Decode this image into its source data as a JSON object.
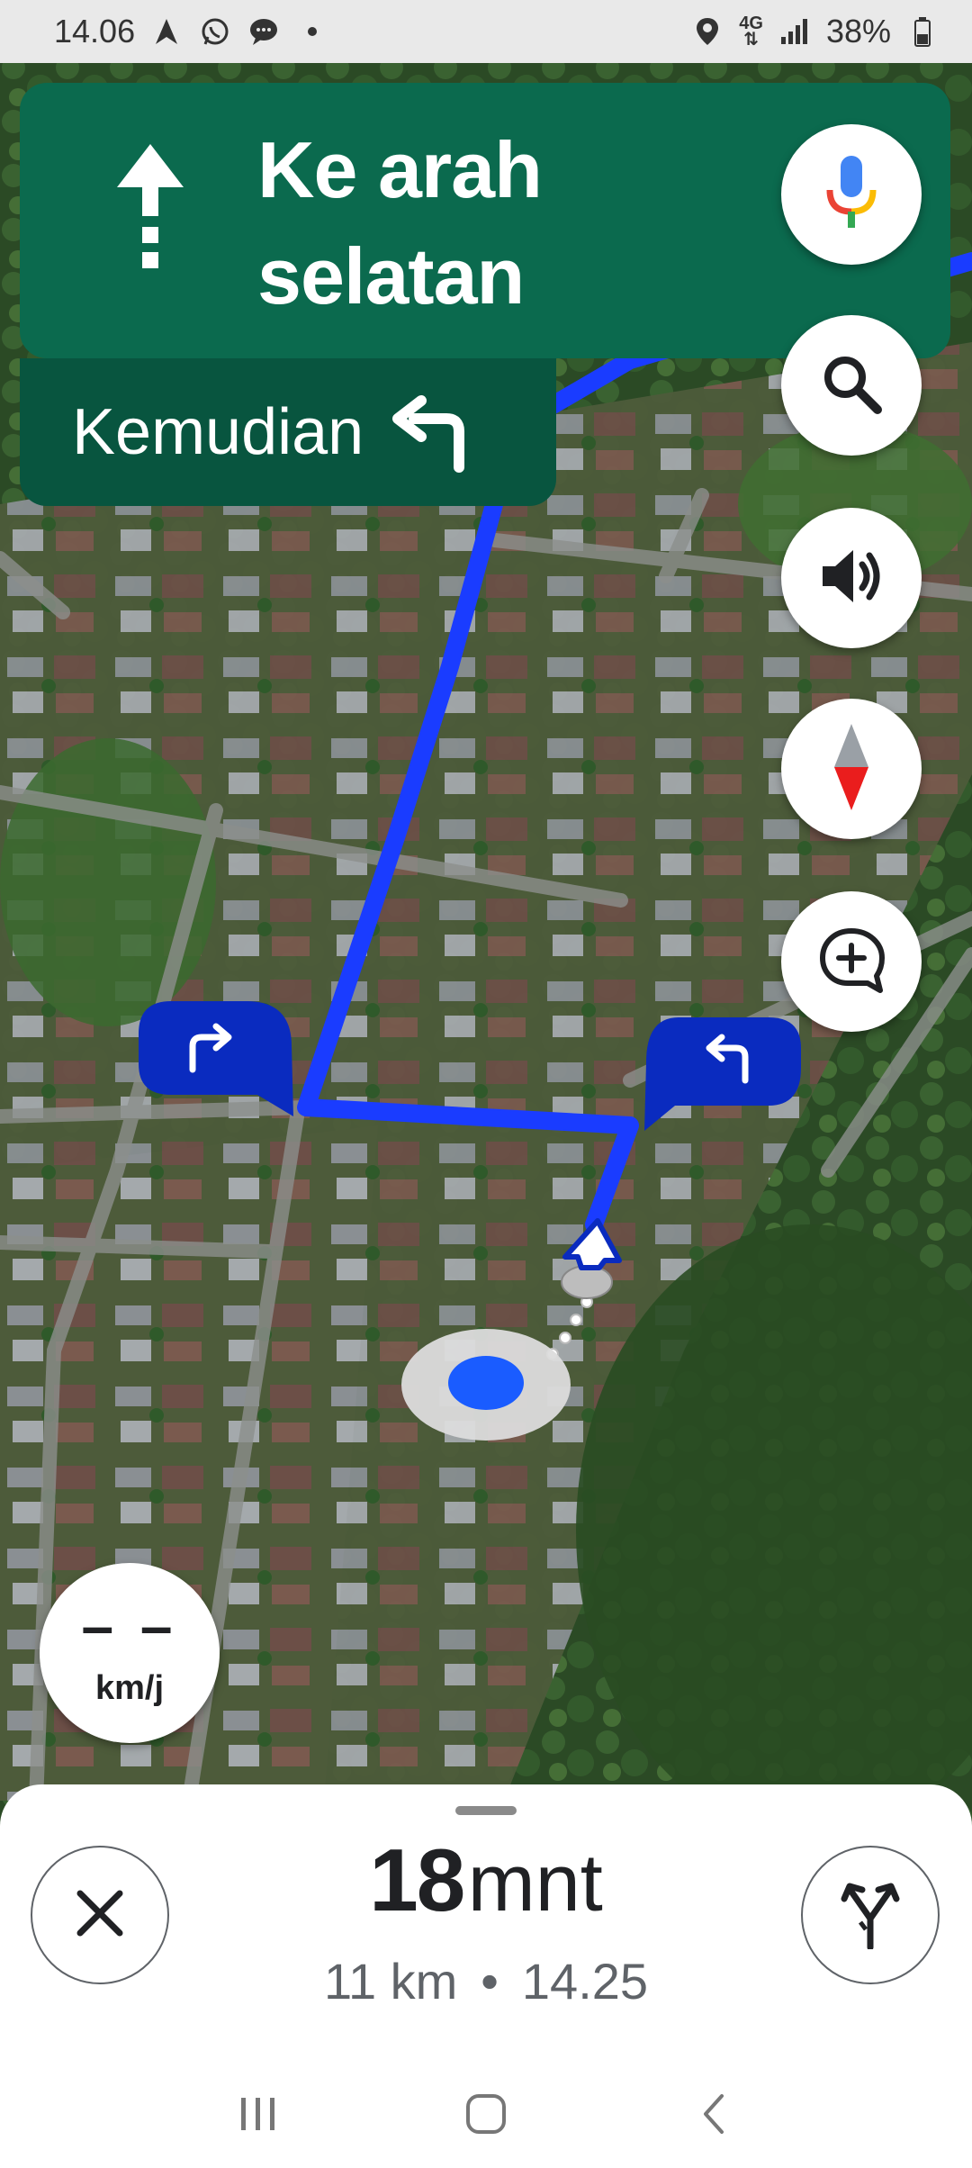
{
  "status_bar": {
    "time": "14.06",
    "network": "4G",
    "battery": "38%",
    "icons_left": [
      "navigation-icon",
      "whatsapp-icon",
      "chat-icon",
      "dot-icon"
    ],
    "icons_right": [
      "location-icon",
      "data-arrows-icon",
      "signal-icon",
      "battery-icon"
    ]
  },
  "direction": {
    "instruction_line1": "Ke arah",
    "instruction_line2": "selatan",
    "then_label": "Kemudian",
    "then_icon": "turn-left-icon",
    "main_icon": "straight-arrow-icon"
  },
  "right_buttons": [
    {
      "name": "voice",
      "icon": "mic-icon"
    },
    {
      "name": "search",
      "icon": "search-icon"
    },
    {
      "name": "sound",
      "icon": "speaker-icon"
    },
    {
      "name": "compass",
      "icon": "compass-icon"
    },
    {
      "name": "report",
      "icon": "add-report-icon"
    }
  ],
  "turn_bubbles": [
    "turn-right-icon",
    "turn-left-icon"
  ],
  "speed": {
    "value": "– –",
    "unit": "km/j"
  },
  "trip": {
    "minutes": "18",
    "minutes_unit": "mnt",
    "distance": "11 km",
    "separator": "•",
    "arrival": "14.25"
  },
  "colors": {
    "direction_card": "#0b6a4e",
    "then_card": "#08553f",
    "route": "#1a3cff",
    "bubble": "#0a2bbf"
  }
}
